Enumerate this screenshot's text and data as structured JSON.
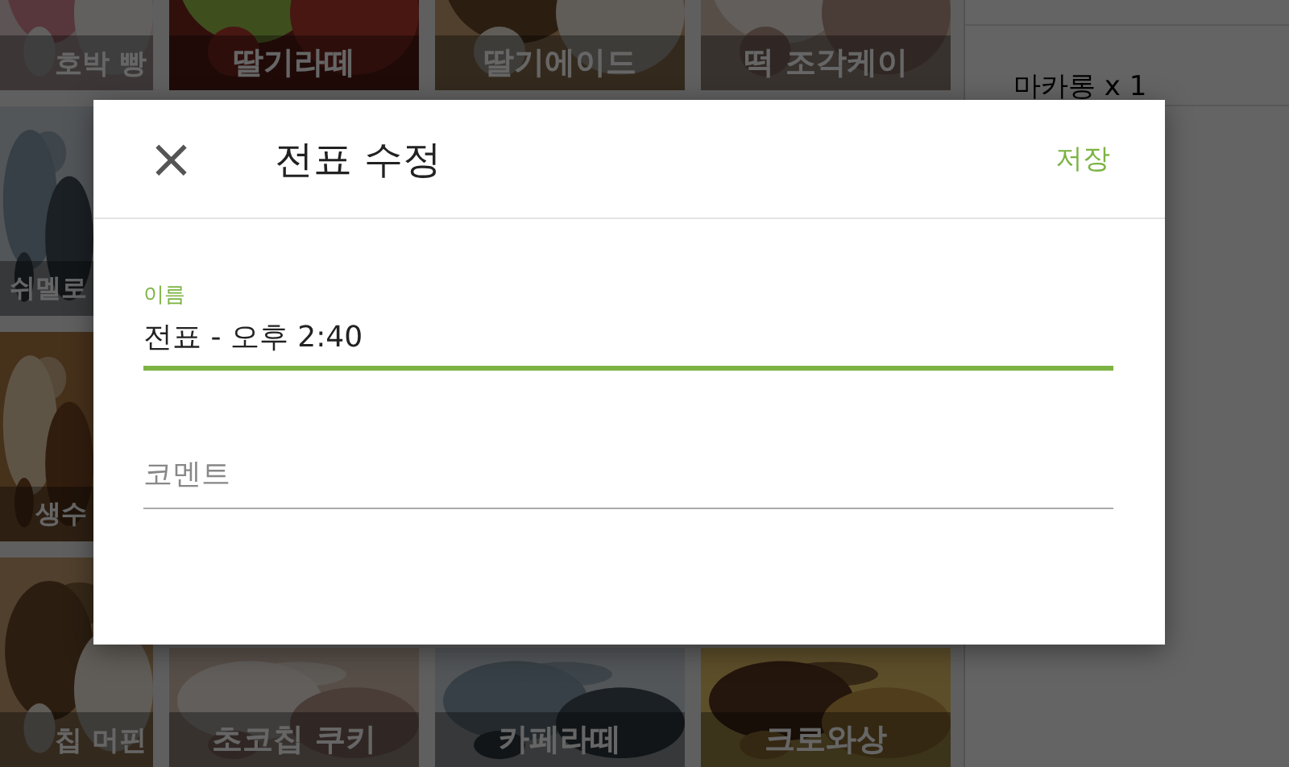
{
  "menu_grid": {
    "rows": [
      [
        {
          "label": "호박 빵"
        },
        {
          "label": "딸기라떼"
        },
        {
          "label": "딸기에이드"
        },
        {
          "label": "떡 조각케이"
        }
      ],
      [
        {
          "label": "쉬멜로"
        }
      ],
      [
        {
          "label": "생수"
        }
      ],
      [
        {
          "label": "칩 머핀"
        },
        {
          "label": "초코칩 쿠키"
        },
        {
          "label": "카페라떼"
        },
        {
          "label": "크로와상"
        }
      ]
    ]
  },
  "order_panel": {
    "items": [
      "마카롱 x 1"
    ]
  },
  "dialog": {
    "title": "전표 수정",
    "close": "×",
    "save": "저장",
    "fields": [
      {
        "label": "이름",
        "value": "전표 - 오후 2:40",
        "focused": true
      },
      {
        "placeholder": "코멘트",
        "focused": false
      }
    ]
  }
}
